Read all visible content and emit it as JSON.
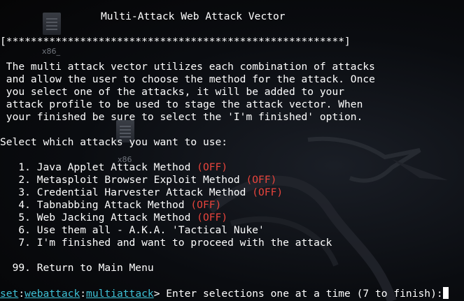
{
  "desktop": {
    "icons": [
      {
        "name": "x86_",
        "label": "x86_"
      },
      {
        "name": "x86",
        "label": "x86"
      }
    ]
  },
  "terminal": {
    "title": "Multi-Attack Web Attack Vector",
    "separator": "[*******************************************************]",
    "description": [
      " The multi attack vector utilizes each combination of attacks",
      " and allow the user to choose the method for the attack. Once",
      " you select one of the attacks, it will be added to your",
      " attack profile to be used to stage the attack vector. When",
      " your finished be sure to select the 'I'm finished' option."
    ],
    "select_prompt": "Select which attacks you want to use:",
    "menu": [
      {
        "num": "   1. ",
        "label": "Java Applet Attack Method",
        "status": "(OFF)"
      },
      {
        "num": "   2. ",
        "label": "Metasploit Browser Exploit Method",
        "status": "(OFF)"
      },
      {
        "num": "   3. ",
        "label": "Credential Harvester Attack Method",
        "status": "(OFF)"
      },
      {
        "num": "   4. ",
        "label": "Tabnabbing Attack Method",
        "status": "(OFF)"
      },
      {
        "num": "   5. ",
        "label": "Web Jacking Attack Method",
        "status": "(OFF)"
      },
      {
        "num": "   6. ",
        "label": "Use them all - A.K.A. 'Tactical Nuke'",
        "status": ""
      },
      {
        "num": "   7. ",
        "label": "I'm finished and want to proceed with the attack",
        "status": ""
      }
    ],
    "return_item": {
      "num": "  99. ",
      "label": "Return to Main Menu"
    },
    "prompt": {
      "seg1": "set",
      "sep": ":",
      "seg2": "webattack",
      "seg3": "multiattack",
      "tail": "> Enter selections one at a time (7 to finish):"
    }
  },
  "colors": {
    "off_status": "#e8443c",
    "prompt_accent": "#3ec1d6",
    "text": "#ffffff",
    "background": "#000000"
  }
}
